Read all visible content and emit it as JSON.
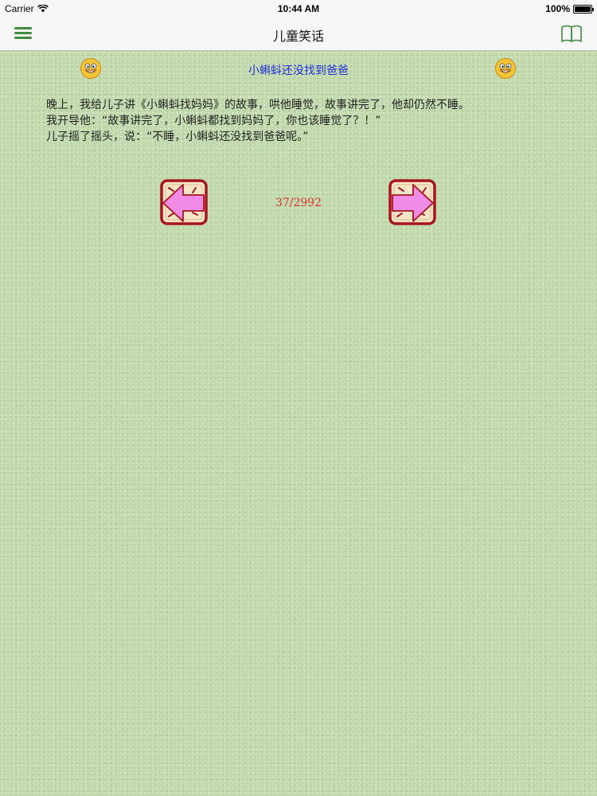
{
  "status_bar": {
    "carrier": "Carrier",
    "time": "10:44 AM",
    "battery_text": "100%",
    "battery_level": 1.0
  },
  "nav_bar": {
    "title": "儿童笑话"
  },
  "story": {
    "title": "小蝌蚪还没找到爸爸",
    "lines": [
      "晚上，我给儿子讲《小蝌蚪找妈妈》的故事，哄他睡觉，故事讲完了，他却仍然不睡。",
      "我开导他：“故事讲完了，小蝌蚪都找到妈妈了，你也该睡觉了？！”",
      "儿子摇了摇头，说：“不睡，小蝌蚪还没找到爸爸呢。”"
    ]
  },
  "pagination": {
    "counter": "37/2992"
  },
  "icons": {
    "menu": "hamburger-icon",
    "book": "book-icon",
    "smiley": "smiley-face-icon",
    "prev": "left-arrow-icon",
    "next": "right-arrow-icon"
  },
  "colors": {
    "accent_green": "#3e8c3e",
    "title_blue": "#1f2fd6",
    "counter_red": "#d8322c",
    "arrow_pink": "#f08ce6",
    "arrow_border": "#a8141e",
    "background": "#c2d9ad"
  }
}
